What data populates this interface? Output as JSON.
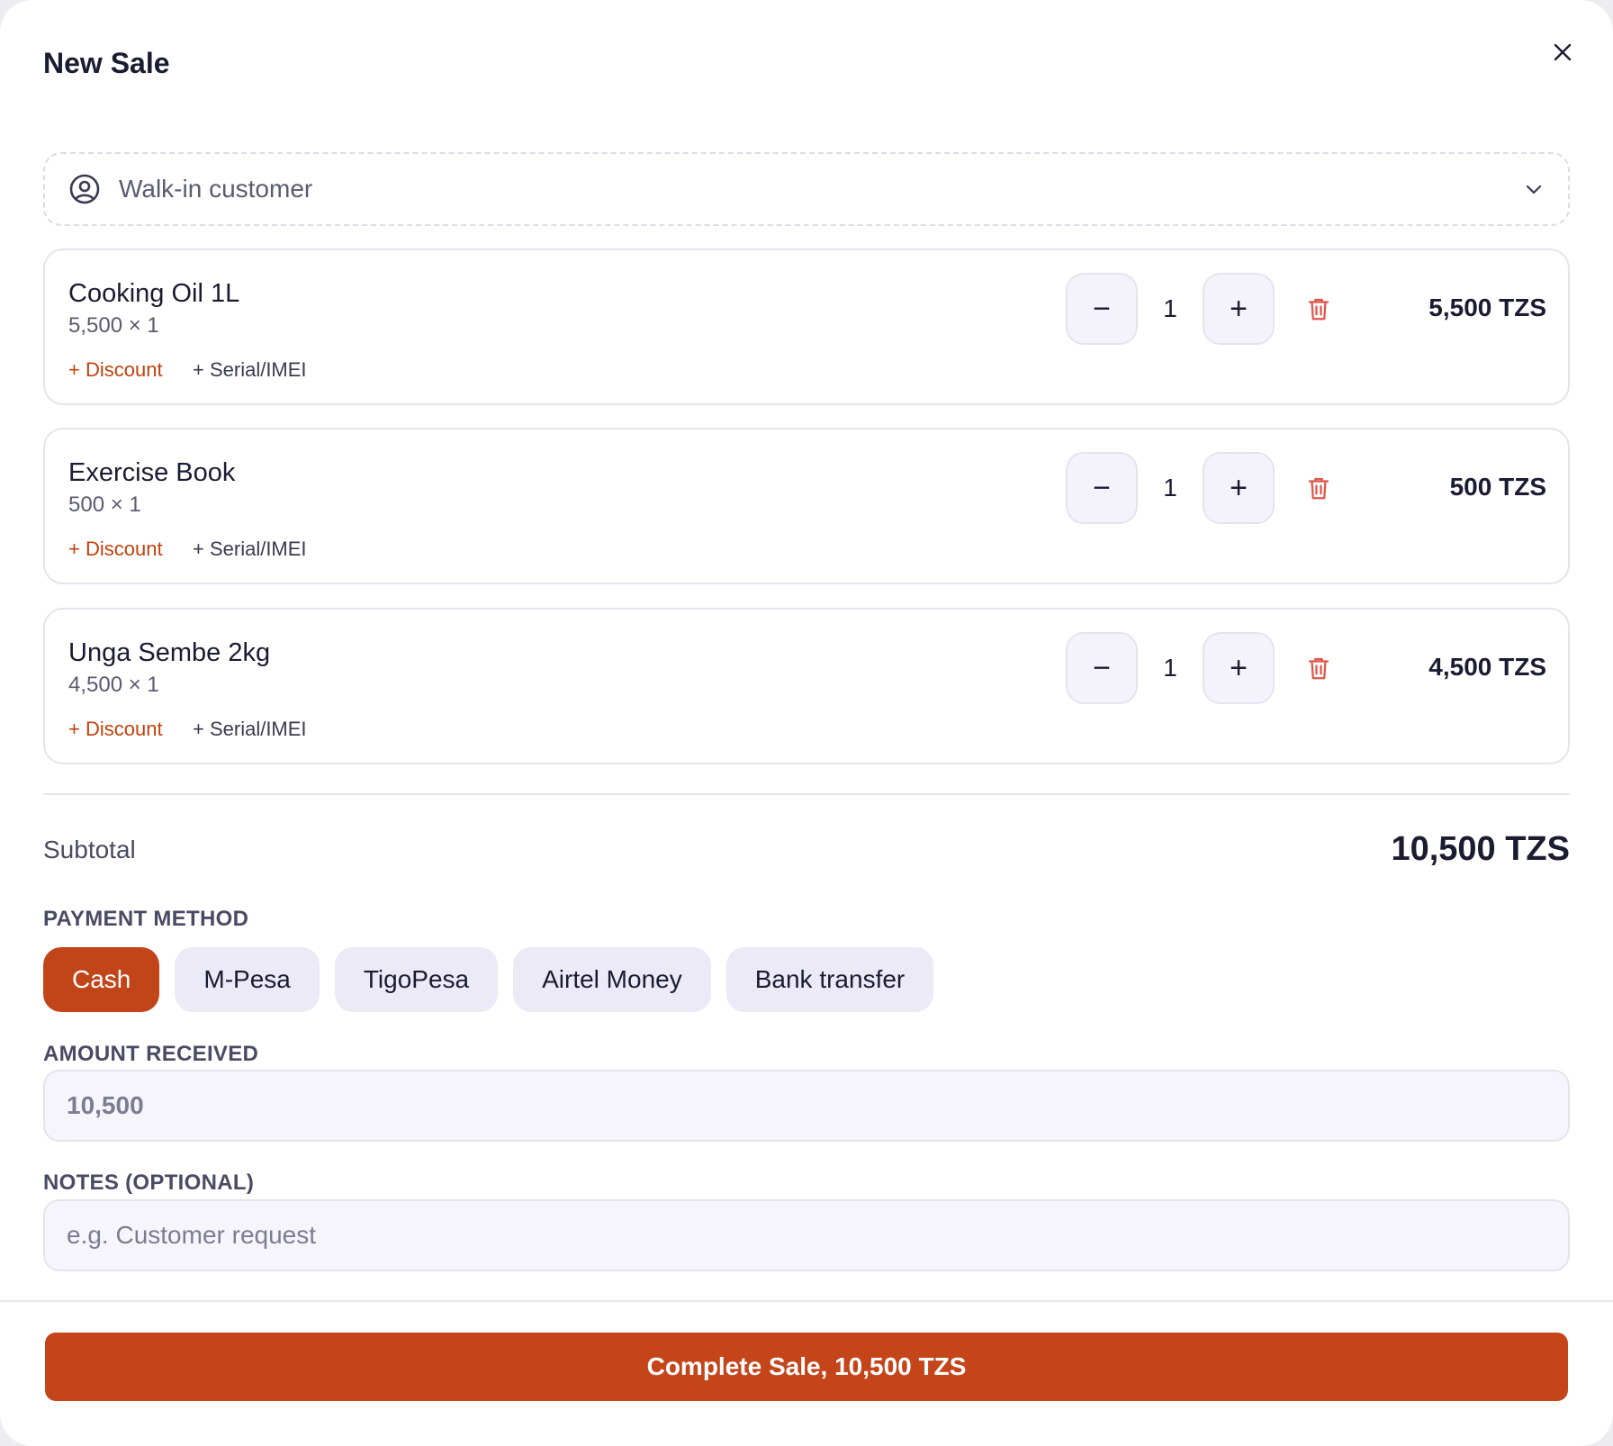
{
  "dialog": {
    "title": "New Sale"
  },
  "customer": {
    "label": "Walk-in customer"
  },
  "items": [
    {
      "name": "Cooking Oil 1L",
      "detail": "5,500 × 1",
      "qty": "1",
      "total": "5,500 TZS",
      "discount_label": "+ Discount",
      "serial_label": "+ Serial/IMEI"
    },
    {
      "name": "Exercise Book",
      "detail": "500 × 1",
      "qty": "1",
      "total": "500 TZS",
      "discount_label": "+ Discount",
      "serial_label": "+ Serial/IMEI"
    },
    {
      "name": "Unga Sembe 2kg",
      "detail": "4,500 × 1",
      "qty": "1",
      "total": "4,500 TZS",
      "discount_label": "+ Discount",
      "serial_label": "+ Serial/IMEI"
    }
  ],
  "qty_controls": {
    "minus": "−",
    "plus": "+"
  },
  "summary": {
    "subtotal_label": "Subtotal",
    "subtotal_value": "10,500 TZS"
  },
  "payment": {
    "label": "PAYMENT METHOD",
    "methods": [
      "Cash",
      "M-Pesa",
      "TigoPesa",
      "Airtel Money",
      "Bank transfer"
    ],
    "selected": "Cash"
  },
  "amount_received": {
    "label": "AMOUNT RECEIVED",
    "placeholder": "10,500"
  },
  "notes": {
    "label": "NOTES (OPTIONAL)",
    "placeholder": "e.g. Customer request"
  },
  "footer": {
    "complete_label": "Complete Sale, 10,500 TZS"
  },
  "colors": {
    "accent": "#c4451a",
    "link_accent": "#c2410c",
    "trash": "#e0564a",
    "chip_bg": "#eceaf6"
  }
}
